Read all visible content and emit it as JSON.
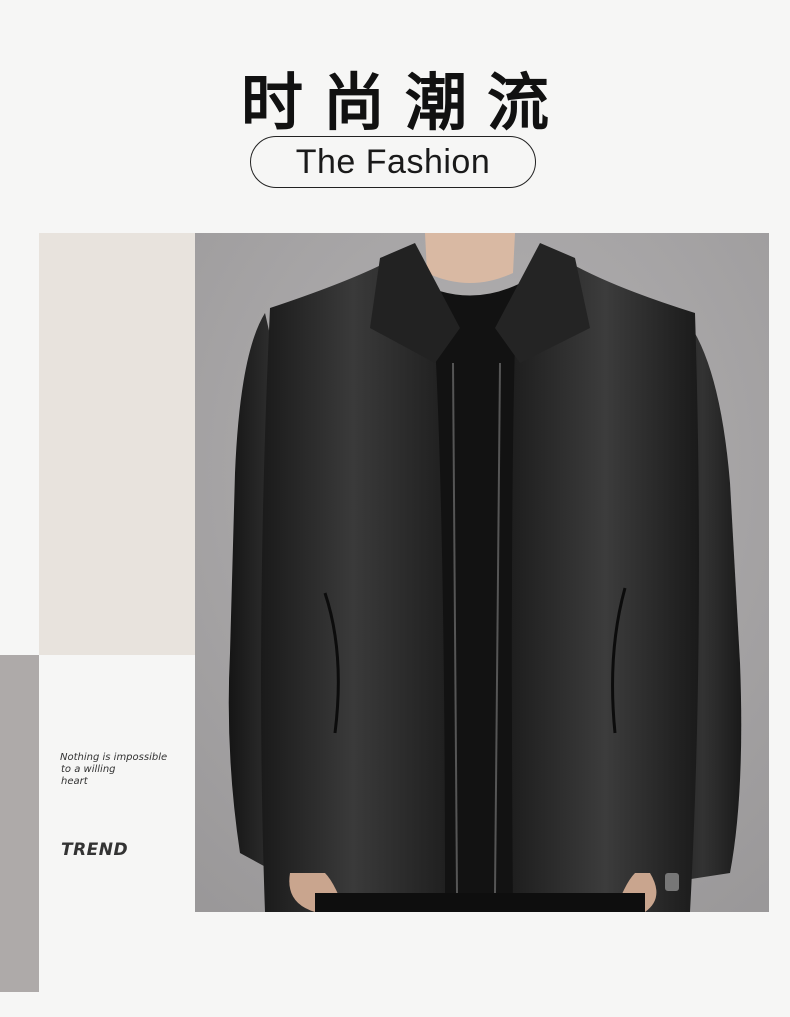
{
  "header": {
    "title_cn": "时尚潮流",
    "subtitle": "The Fashion"
  },
  "side": {
    "tagline_lines": [
      "Nothing is impossible",
      "to a willing",
      "heart"
    ],
    "trend_label": "TREND"
  },
  "colors": {
    "background": "#f6f6f5",
    "beige_block": "#e8e3dd",
    "gray_block": "#aeaaa9",
    "photo_background": "#a8a6a7",
    "text": "#111111"
  },
  "product_image": {
    "subject": "black leather jacket worn over black crew-neck sweater"
  }
}
